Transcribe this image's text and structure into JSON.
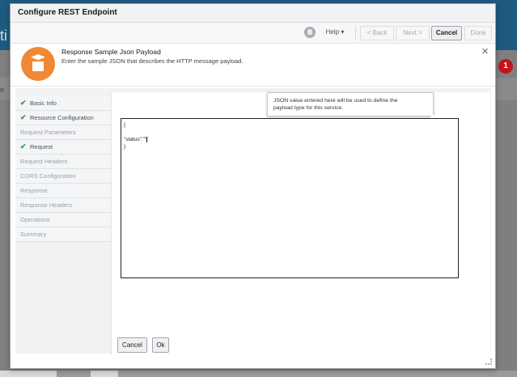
{
  "background": {
    "app_title_fragment": "ti",
    "left_label_fragment": "n",
    "notification_count": "1"
  },
  "dialog": {
    "title": "Configure REST Endpoint",
    "toolbar": {
      "help_label": "Help ▾",
      "back_label": "< Back",
      "next_label": "Next >",
      "cancel_label": "Cancel",
      "done_label": "Done"
    },
    "info": {
      "title": "Response Sample Json Payload",
      "description": "Enter the sample JSON that describes the HTTP message payload.",
      "close_glyph": "✕"
    },
    "steps": [
      {
        "label": "Basic Info",
        "completed": true
      },
      {
        "label": "Resource Configuration",
        "completed": true
      },
      {
        "label": "Request Parameters",
        "completed": false
      },
      {
        "label": "Request",
        "completed": true
      },
      {
        "label": "Request Headers",
        "completed": false
      },
      {
        "label": "CORS Configuration",
        "completed": false
      },
      {
        "label": "Response",
        "completed": false
      },
      {
        "label": "Response Headers",
        "completed": false
      },
      {
        "label": "Operations",
        "completed": false
      },
      {
        "label": "Summary",
        "completed": false
      }
    ],
    "tooltip": {
      "line1": "JSON value entered here will be used to define the",
      "line2": "payload type for this service."
    },
    "editor": {
      "lines": [
        "{",
        "\"status\":\"\"",
        "}"
      ]
    },
    "buttons": {
      "cancel_label": "Cancel",
      "ok_label": "Ok"
    }
  },
  "colors": {
    "header_blue": "#1e5a7e",
    "info_icon_orange": "#f08834",
    "check_green": "#3a9a3f",
    "badge_red": "#c4141b"
  }
}
